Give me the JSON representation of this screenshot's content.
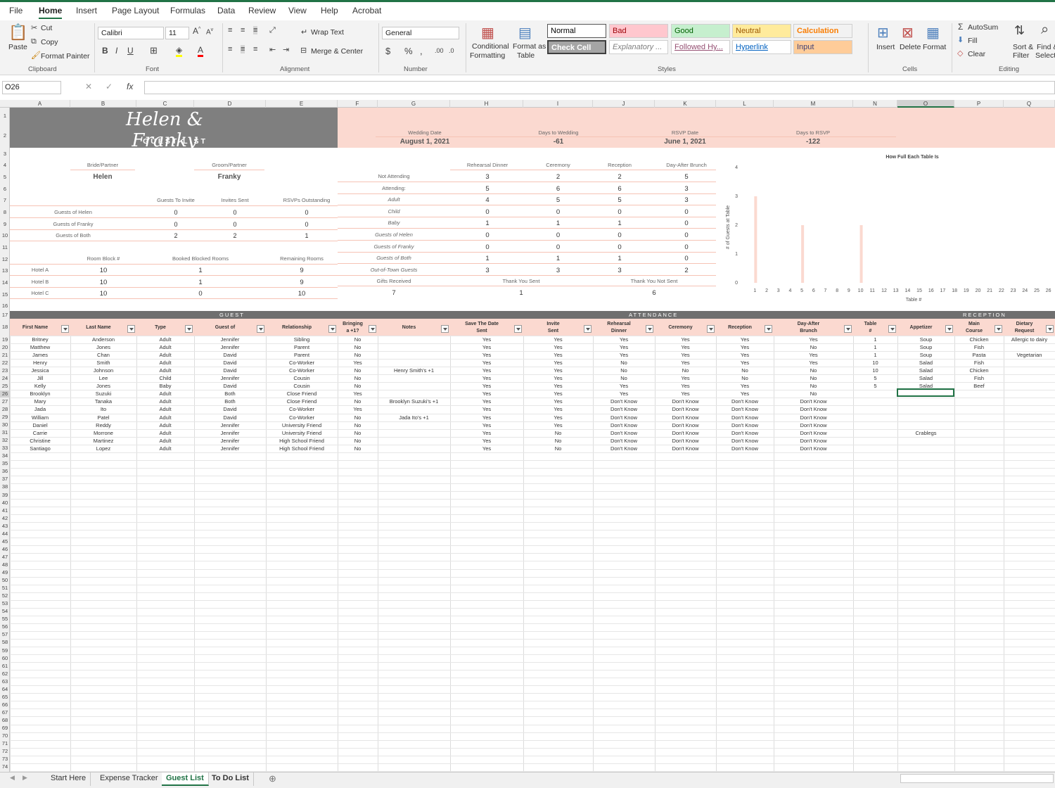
{
  "menu": {
    "tabs": [
      "File",
      "Home",
      "Insert",
      "Page Layout",
      "Formulas",
      "Data",
      "Review",
      "View",
      "Help",
      "Acrobat"
    ],
    "active": "Home"
  },
  "ribbon": {
    "clipboard": {
      "paste": "Paste",
      "cut": "Cut",
      "copy": "Copy",
      "format_painter": "Format Painter",
      "label": "Clipboard"
    },
    "font": {
      "name": "Calibri",
      "size": "11",
      "label": "Font"
    },
    "alignment": {
      "wrap_text": "Wrap Text",
      "merge_center": "Merge & Center",
      "label": "Alignment"
    },
    "number": {
      "format": "General",
      "label": "Number"
    },
    "styles": {
      "conditional": "Conditional\nFormatting",
      "conditional_1": "Conditional",
      "conditional_2": "Formatting",
      "format_table_1": "Format as",
      "format_table_2": "Table",
      "cells": [
        {
          "text": "Normal",
          "bg": "#ffffff",
          "fg": "#000000"
        },
        {
          "text": "Bad",
          "bg": "#ffc7ce",
          "fg": "#9c0006"
        },
        {
          "text": "Good",
          "bg": "#c6efce",
          "fg": "#006100"
        },
        {
          "text": "Neutral",
          "bg": "#ffeb9c",
          "fg": "#9c5700"
        },
        {
          "text": "Calculation",
          "bg": "#f2f2f2",
          "fg": "#fa7d00"
        },
        {
          "text": "Check Cell",
          "bg": "#a5a5a5",
          "fg": "#ffffff"
        },
        {
          "text": "Explanatory ...",
          "bg": "#ffffff",
          "fg": "#7f7f7f"
        },
        {
          "text": "Followed Hy...",
          "bg": "#ffffff",
          "fg": "#954f72"
        },
        {
          "text": "Hyperlink",
          "bg": "#ffffff",
          "fg": "#0563c1"
        },
        {
          "text": "Input",
          "bg": "#ffcc99",
          "fg": "#3f3f76"
        }
      ],
      "label": "Styles"
    },
    "cells": {
      "insert": "Insert",
      "delete": "Delete",
      "format": "Format",
      "label": "Cells"
    },
    "editing": {
      "autosum": "AutoSum",
      "fill": "Fill",
      "clear": "Clear",
      "sort_1": "Sort &",
      "sort_2": "Filter",
      "find_1": "Find &",
      "find_2": "Select",
      "label": "Editing"
    }
  },
  "formula_bar": {
    "name_box": "O26",
    "fx": "fx",
    "value": ""
  },
  "columns": [
    "A",
    "B",
    "C",
    "D",
    "E",
    "F",
    "G",
    "H",
    "I",
    "J",
    "K",
    "L",
    "M",
    "N",
    "O",
    "P",
    "Q"
  ],
  "selected_column": "O",
  "selected_row": 26,
  "title": {
    "names": "Helen & Franky",
    "subtitle": "GUEST LIST"
  },
  "header_info": {
    "wedding_date_label": "Wedding Date",
    "wedding_date": "August 1, 2021",
    "days_to_wedding_label": "Days to Wedding",
    "days_to_wedding": "-61",
    "rsvp_date_label": "RSVP Date",
    "rsvp_date": "June 1, 2021",
    "days_to_rsvp_label": "Days to RSVP",
    "days_to_rsvp": "-122"
  },
  "couple": {
    "bride_label": "Bride/Partner",
    "bride": "Helen",
    "groom_label": "Groom/Partner",
    "groom": "Franky"
  },
  "invite_summary": {
    "headers": [
      "Guests To Invite",
      "Invites Sent",
      "RSVPs Outstanding"
    ],
    "rows": [
      {
        "label": "Guests of Helen",
        "values": [
          "0",
          "0",
          "0"
        ]
      },
      {
        "label": "Guests of Franky",
        "values": [
          "0",
          "0",
          "0"
        ]
      },
      {
        "label": "Guests of Both",
        "values": [
          "2",
          "2",
          "1"
        ]
      }
    ]
  },
  "rooms": {
    "headers": [
      "Room Block #",
      "Booked Blocked Rooms",
      "Remaining Rooms"
    ],
    "rows": [
      {
        "label": "Hotel A",
        "values": [
          "10",
          "1",
          "9"
        ]
      },
      {
        "label": "Hotel B",
        "values": [
          "10",
          "1",
          "9"
        ]
      },
      {
        "label": "Hotel C",
        "values": [
          "10",
          "0",
          "10"
        ]
      }
    ]
  },
  "attendance_summary": {
    "headers": [
      "Rehearsal Dinner",
      "Ceremony",
      "Reception",
      "Day-After Brunch"
    ],
    "rows": [
      {
        "label": "Not Attending",
        "italic": false,
        "values": [
          "3",
          "2",
          "2",
          "5"
        ]
      },
      {
        "label": "Attending:",
        "italic": false,
        "values": [
          "5",
          "6",
          "6",
          "3"
        ]
      },
      {
        "label": "Adult",
        "italic": true,
        "values": [
          "4",
          "5",
          "5",
          "3"
        ]
      },
      {
        "label": "Child",
        "italic": true,
        "values": [
          "0",
          "0",
          "0",
          "0"
        ]
      },
      {
        "label": "Baby",
        "italic": true,
        "values": [
          "1",
          "1",
          "1",
          "0"
        ]
      },
      {
        "label": "Guests of Helen",
        "italic": true,
        "values": [
          "0",
          "0",
          "0",
          "0"
        ]
      },
      {
        "label": "Guests of Franky",
        "italic": true,
        "values": [
          "0",
          "0",
          "0",
          "0"
        ]
      },
      {
        "label": "Guests of Both",
        "italic": true,
        "values": [
          "1",
          "1",
          "1",
          "0"
        ]
      },
      {
        "label": "Out-of-Town Guests",
        "italic": true,
        "values": [
          "3",
          "3",
          "3",
          "2"
        ]
      }
    ],
    "gifts_received_label": "Gifts Received",
    "gifts_received": "7",
    "thank_you_sent_label": "Thank You Sent",
    "thank_you_sent": "1",
    "thank_you_not_sent_label": "Thank You Not Sent",
    "thank_you_not_sent": "6"
  },
  "chart_data": {
    "type": "bar",
    "title": "How Full Each Table Is",
    "xlabel": "Table #",
    "ylabel": "# of Guests at Table",
    "categories": [
      "1",
      "2",
      "3",
      "4",
      "5",
      "6",
      "7",
      "8",
      "9",
      "10",
      "11",
      "12",
      "13",
      "14",
      "15",
      "16",
      "17",
      "18",
      "19",
      "20",
      "21",
      "22",
      "23",
      "24",
      "25",
      "26"
    ],
    "values": [
      3,
      0,
      0,
      0,
      2,
      0,
      0,
      0,
      0,
      2,
      0,
      0,
      0,
      0,
      0,
      0,
      0,
      0,
      0,
      0,
      0,
      0,
      0,
      0,
      0,
      0
    ],
    "ylim": [
      0,
      4
    ],
    "yticks": [
      "0",
      "1",
      "2",
      "3",
      "4"
    ],
    "bar_color": "#fbd9d0",
    "grid": false
  },
  "bands": {
    "guest": "GUEST",
    "attendance": "ATTENDANCE",
    "reception": "RECEPTION"
  },
  "table_headers": {
    "first_name": "First Name",
    "last_name": "Last Name",
    "type": "Type",
    "guest_of": "Guest of",
    "relationship": "Relationship",
    "plus1_1": "Bringing",
    "plus1_2": "a +1?",
    "notes": "Notes",
    "std_1": "Save The Date",
    "std_2": "Sent",
    "inv_1": "Invite",
    "inv_2": "Sent",
    "reh_1": "Rehearsal",
    "reh_2": "Dinner",
    "ceremony": "Ceremony",
    "reception": "Reception",
    "brunch_1": "Day-After",
    "brunch_2": "Brunch",
    "table_1": "Table",
    "table_2": "#",
    "appetizer": "Appetizer",
    "main_1": "Main",
    "main_2": "Course",
    "diet_1": "Dietary",
    "diet_2": "Request"
  },
  "guests": [
    [
      "Britney",
      "Anderson",
      "Adult",
      "Jennifer",
      "Sibling",
      "No",
      "",
      "Yes",
      "Yes",
      "Yes",
      "Yes",
      "Yes",
      "Yes",
      "1",
      "Soup",
      "Chicken",
      "Allergic to dairy"
    ],
    [
      "Matthew",
      "Jones",
      "Adult",
      "Jennifer",
      "Parent",
      "No",
      "",
      "Yes",
      "Yes",
      "Yes",
      "Yes",
      "Yes",
      "No",
      "1",
      "Soup",
      "Fish",
      ""
    ],
    [
      "James",
      "Chan",
      "Adult",
      "David",
      "Parent",
      "No",
      "",
      "Yes",
      "Yes",
      "Yes",
      "Yes",
      "Yes",
      "Yes",
      "1",
      "Soup",
      "Pasta",
      "Vegetarian"
    ],
    [
      "Henry",
      "Smith",
      "Adult",
      "David",
      "Co-Worker",
      "Yes",
      "",
      "Yes",
      "Yes",
      "No",
      "Yes",
      "Yes",
      "Yes",
      "10",
      "Salad",
      "Fish",
      ""
    ],
    [
      "Jessica",
      "Johnson",
      "Adult",
      "David",
      "Co-Worker",
      "No",
      "Henry Smith's +1",
      "Yes",
      "Yes",
      "No",
      "No",
      "No",
      "No",
      "10",
      "Salad",
      "Chicken",
      ""
    ],
    [
      "Jill",
      "Lee",
      "Child",
      "Jennifer",
      "Cousin",
      "No",
      "",
      "Yes",
      "Yes",
      "No",
      "Yes",
      "No",
      "No",
      "5",
      "Salad",
      "Fish",
      ""
    ],
    [
      "Kelly",
      "Jones",
      "Baby",
      "David",
      "Cousin",
      "No",
      "",
      "Yes",
      "Yes",
      "Yes",
      "Yes",
      "Yes",
      "No",
      "5",
      "Salad",
      "Beef",
      ""
    ],
    [
      "Brooklyn",
      "Suzuki",
      "Adult",
      "Both",
      "Close Friend",
      "Yes",
      "",
      "Yes",
      "Yes",
      "Yes",
      "Yes",
      "Yes",
      "No",
      "",
      "",
      "",
      ""
    ],
    [
      "Mary",
      "Tanaka",
      "Adult",
      "Both",
      "Close Friend",
      "No",
      "Brooklyn Suzuki's +1",
      "Yes",
      "Yes",
      "Don't Know",
      "Don't Know",
      "Don't Know",
      "Don't Know",
      "",
      "",
      "",
      ""
    ],
    [
      "Jada",
      "Ito",
      "Adult",
      "David",
      "Co-Worker",
      "Yes",
      "",
      "Yes",
      "Yes",
      "Don't Know",
      "Don't Know",
      "Don't Know",
      "Don't Know",
      "",
      "",
      "",
      ""
    ],
    [
      "William",
      "Patel",
      "Adult",
      "David",
      "Co-Worker",
      "No",
      "Jada Ito's +1",
      "Yes",
      "Yes",
      "Don't Know",
      "Don't Know",
      "Don't Know",
      "Don't Know",
      "",
      "",
      "",
      ""
    ],
    [
      "Daniel",
      "Reddy",
      "Adult",
      "Jennifer",
      "University Friend",
      "No",
      "",
      "Yes",
      "Yes",
      "Don't Know",
      "Don't Know",
      "Don't Know",
      "Don't Know",
      "",
      "",
      "",
      ""
    ],
    [
      "Carrie",
      "Morrone",
      "Adult",
      "Jennifer",
      "University Friend",
      "No",
      "",
      "Yes",
      "No",
      "Don't Know",
      "Don't Know",
      "Don't Know",
      "Don't Know",
      "",
      "Crablegs",
      "",
      ""
    ],
    [
      "Christine",
      "Martinez",
      "Adult",
      "Jennifer",
      "High School Friend",
      "No",
      "",
      "Yes",
      "No",
      "Don't Know",
      "Don't Know",
      "Don't Know",
      "Don't Know",
      "",
      "",
      "",
      ""
    ],
    [
      "Santiago",
      "Lopez",
      "Adult",
      "Jennifer",
      "High School Friend",
      "No",
      "",
      "Yes",
      "No",
      "Don't Know",
      "Don't Know",
      "Don't Know",
      "Don't Know",
      "",
      "",
      "",
      ""
    ]
  ],
  "sheet_tabs": [
    "Start Here",
    "Expense Tracker",
    "Guest List",
    "To Do List"
  ],
  "active_sheet": "Guest List"
}
